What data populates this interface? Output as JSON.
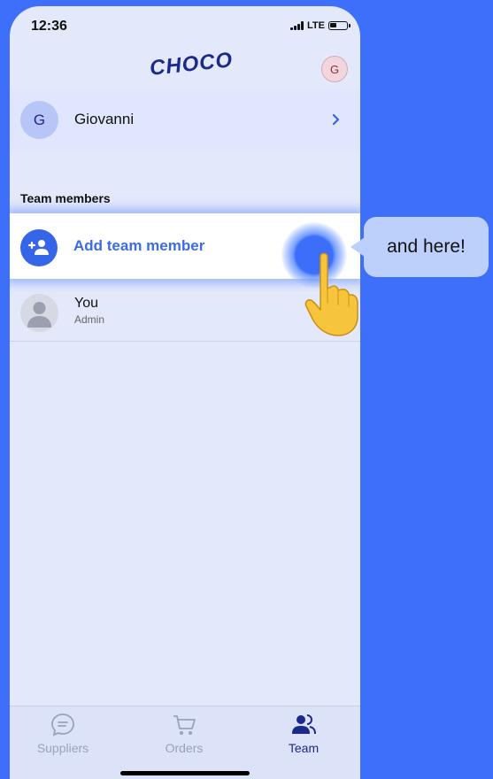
{
  "status_bar": {
    "time": "12:36",
    "network": "LTE"
  },
  "header": {
    "logo_text": "CHOCO",
    "avatar_initial": "G"
  },
  "profile": {
    "initial": "G",
    "name": "Giovanni"
  },
  "team": {
    "section_title": "Team members",
    "add_label": "Add team member",
    "members": [
      {
        "name": "You",
        "role": "Admin"
      }
    ]
  },
  "tooltip": {
    "text": "and here!"
  },
  "tabs": [
    {
      "label": "Suppliers",
      "icon": "chat-icon",
      "active": false
    },
    {
      "label": "Orders",
      "icon": "cart-icon",
      "active": false
    },
    {
      "label": "Team",
      "icon": "team-icon",
      "active": true
    }
  ],
  "colors": {
    "accent": "#3b6be6",
    "background": "#3d6ffb",
    "inactive_tab": "#9aa3b8",
    "active_tab": "#1b2a8a"
  }
}
